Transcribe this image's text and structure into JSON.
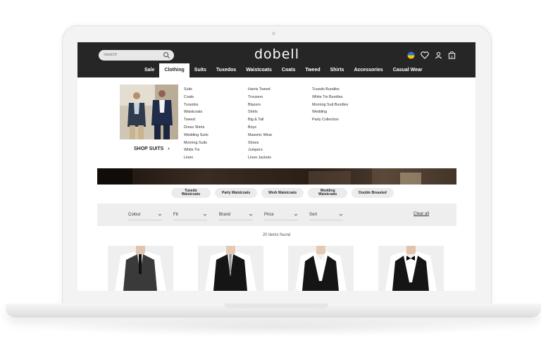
{
  "site": {
    "logo": "dobell"
  },
  "header": {
    "search_placeholder": "Search",
    "icons": [
      "flag-icon",
      "heart-icon",
      "user-icon",
      "bag-icon"
    ],
    "bag_count": "0"
  },
  "nav": {
    "items": [
      {
        "label": "Sale",
        "active": false
      },
      {
        "label": "Clothing",
        "active": true
      },
      {
        "label": "Suits",
        "active": false
      },
      {
        "label": "Tuxedos",
        "active": false
      },
      {
        "label": "Waistcoats",
        "active": false
      },
      {
        "label": "Coats",
        "active": false
      },
      {
        "label": "Tweed",
        "active": false
      },
      {
        "label": "Shirts",
        "active": false
      },
      {
        "label": "Accessories",
        "active": false
      },
      {
        "label": "Casual Wear",
        "active": false
      }
    ]
  },
  "mega_menu": {
    "shop_link": "SHOP SUITS",
    "columns": [
      [
        "Suits",
        "Coats",
        "Tuxedos",
        "Waistcoats",
        "Tweed",
        "Dress Shirts",
        "Wedding Suits",
        "Morning Suits",
        "White Tie",
        "Linen"
      ],
      [
        "Harris Tweed",
        "Trousers",
        "Blazers",
        "Shirts",
        "Big & Tall",
        "Boys",
        "Masonic Wear",
        "Shoes",
        "Jumpers",
        "Linen Jackets"
      ],
      [
        "Tuxedo Bundles",
        "White Tie Bundles",
        "Morning Suit Bundles",
        "Wedding",
        "Party Collection"
      ]
    ]
  },
  "pills": [
    {
      "line1": "Tuxedo",
      "line2": "Waistcoats"
    },
    {
      "line1": "Party Waistcoats",
      "line2": ""
    },
    {
      "line1": "Work Waistcoats",
      "line2": ""
    },
    {
      "line1": "Wedding",
      "line2": "Waistcoats"
    },
    {
      "line1": "Double Breasted",
      "line2": ""
    }
  ],
  "filters": {
    "items": [
      "Colour",
      "Fit",
      "Brand",
      "Price",
      "Sort"
    ],
    "clear_label": "Clear all"
  },
  "results": {
    "count_label": "20 items found"
  },
  "colors": {
    "header_bg": "#262626",
    "filter_bg": "#eeeeee",
    "pill_bg": "#ececec"
  }
}
